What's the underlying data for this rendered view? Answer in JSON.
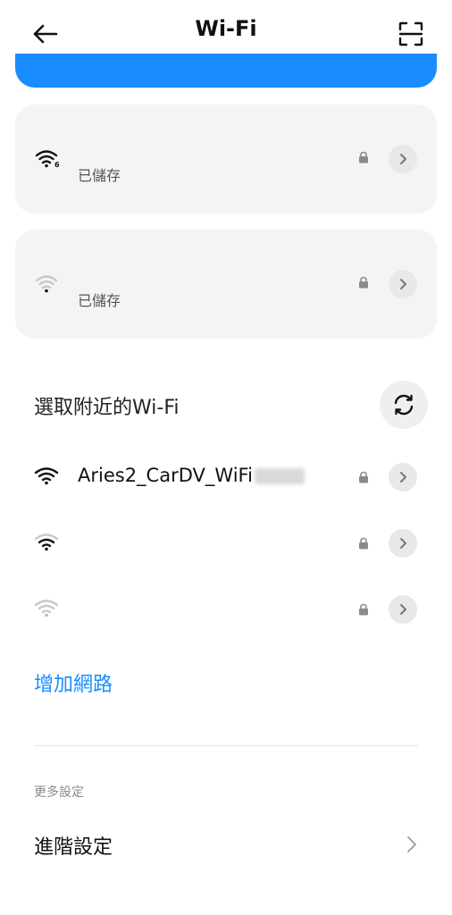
{
  "header": {
    "title": "Wi-Fi",
    "back_icon": "back-arrow-icon",
    "scan_icon": "scan-qr-icon"
  },
  "saved_networks": [
    {
      "status": "已儲存",
      "signal": "wifi6-full",
      "locked": true
    },
    {
      "status": "已儲存",
      "signal": "wifi-weak",
      "locked": true
    }
  ],
  "nearby": {
    "title": "選取附近的Wi-Fi",
    "refresh_icon": "refresh-icon",
    "networks": [
      {
        "ssid": "Aries2_CarDV_WiFi",
        "signal": "wifi-full",
        "locked": true
      },
      {
        "ssid": "",
        "signal": "wifi-medium",
        "locked": true
      },
      {
        "ssid": "",
        "signal": "wifi-weak",
        "locked": true
      }
    ]
  },
  "add_network_label": "增加網路",
  "more_settings": {
    "section_label": "更多設定",
    "advanced_label": "進階設定"
  },
  "colors": {
    "accent": "#1a8cff",
    "card_bg": "#f4f4f4"
  }
}
